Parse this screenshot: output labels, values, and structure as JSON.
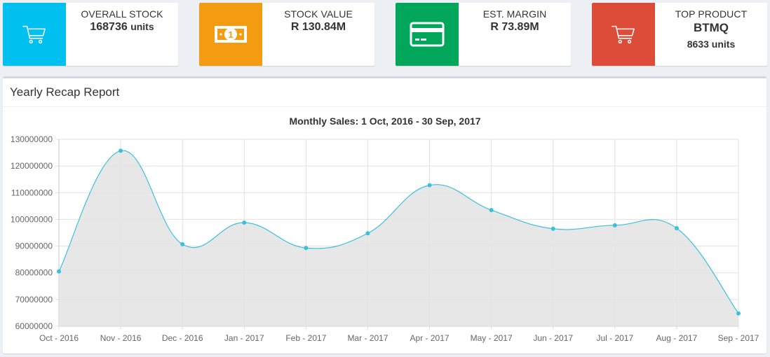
{
  "stats": [
    {
      "label": "OVERALL STOCK",
      "value": "168736",
      "unit": "units",
      "icon": "shopping-cart-icon",
      "color": "#00c0ef"
    },
    {
      "label": "STOCK VALUE",
      "value": "R 130.84M",
      "icon": "money-icon",
      "color": "#f39c12"
    },
    {
      "label": "EST. MARGIN",
      "value": "R 73.89M",
      "icon": "credit-card-icon",
      "color": "#00a65a"
    },
    {
      "label": "TOP PRODUCT",
      "value": "BTMQ",
      "sub": "8633 units",
      "icon": "shopping-cart-icon",
      "color": "#dd4b39"
    }
  ],
  "report": {
    "title": "Yearly Recap Report"
  },
  "chart_data": {
    "type": "area",
    "title": "Monthly Sales: 1 Oct, 2016 - 30 Sep, 2017",
    "categories": [
      "Oct - 2016",
      "Nov - 2016",
      "Dec - 2016",
      "Jan - 2017",
      "Feb - 2017",
      "Mar - 2017",
      "Apr - 2017",
      "May - 2017",
      "Jun - 2017",
      "Jul - 2017",
      "Aug - 2017",
      "Sep - 2017"
    ],
    "values": [
      80500000,
      125700000,
      90700000,
      98800000,
      89300000,
      94800000,
      112800000,
      103500000,
      96500000,
      97800000,
      96700000,
      64800000
    ],
    "ylim": [
      60000000,
      130000000
    ],
    "yticks": [
      "60000000",
      "70000000",
      "80000000",
      "90000000",
      "100000000",
      "110000000",
      "120000000",
      "130000000"
    ],
    "grid": true,
    "line_color": "#3bc0dc",
    "fill_color": "#e3e3e3"
  }
}
